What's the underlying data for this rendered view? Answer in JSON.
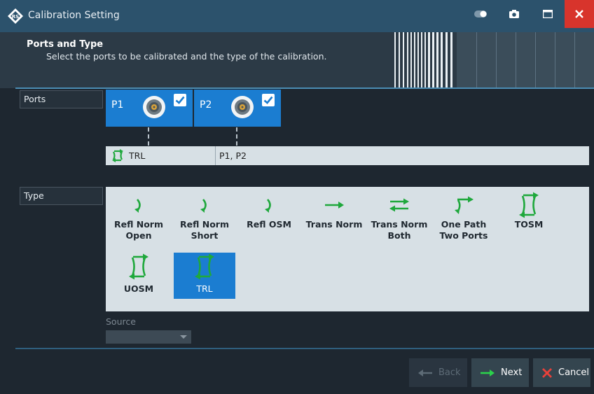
{
  "window": {
    "title": "Calibration Setting",
    "icons": [
      "rohde-schwarz-logo-icon",
      "toggle-icon",
      "camera-icon",
      "maximize-icon",
      "close-icon"
    ]
  },
  "header": {
    "title": "Ports and Type",
    "subtitle": "Select the ports to be calibrated and the type of the calibration."
  },
  "ports_section": {
    "label": "Ports",
    "ports": [
      {
        "name": "P1",
        "checked": true
      },
      {
        "name": "P2",
        "checked": true
      }
    ],
    "cal_row": {
      "type": "TRL",
      "ports": "P1, P2"
    }
  },
  "type_section": {
    "label": "Type",
    "items": [
      {
        "label1": "Refl Norm",
        "label2": "Open",
        "icon": "refl-icon"
      },
      {
        "label1": "Refl Norm",
        "label2": "Short",
        "icon": "refl-icon"
      },
      {
        "label1": "Refl OSM",
        "label2": "",
        "icon": "refl-icon"
      },
      {
        "label1": "Trans Norm",
        "label2": "",
        "icon": "trans-arrow-icon"
      },
      {
        "label1": "Trans Norm",
        "label2": "Both",
        "icon": "trans-both-icon"
      },
      {
        "label1": "One Path",
        "label2": "Two Ports",
        "icon": "one-path-icon"
      },
      {
        "label1": "TOSM",
        "label2": "",
        "icon": "two-port-cal-icon"
      },
      {
        "label1": "UOSM",
        "label2": "",
        "icon": "two-port-cal-icon"
      },
      {
        "label1": "TRL",
        "label2": "",
        "icon": "two-port-cal-icon",
        "selected": true
      }
    ]
  },
  "source": {
    "label": "Source",
    "value": ""
  },
  "footer": {
    "back": "Back",
    "next": "Next",
    "cancel": "Cancel"
  },
  "colors": {
    "accent": "#1b7dd1",
    "icon_green": "#1fa83c",
    "close_red": "#d8342c",
    "titlebar": "#2c526c"
  }
}
